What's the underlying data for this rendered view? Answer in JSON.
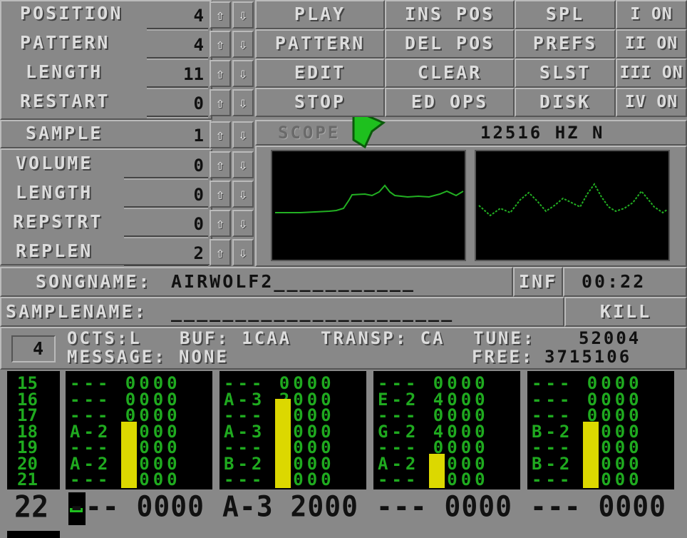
{
  "song_panel": {
    "rows": [
      {
        "label": "POSITION",
        "value": "4"
      },
      {
        "label": "PATTERN",
        "value": "4"
      },
      {
        "label": "LENGTH",
        "value": "11"
      },
      {
        "label": "RESTART",
        "value": "0"
      }
    ],
    "up_icon": "arrow-up-icon",
    "down_icon": "arrow-down-icon"
  },
  "sample_panel": {
    "rows": [
      {
        "label": "SAMPLE",
        "value": "1"
      },
      {
        "label": "VOLUME",
        "value": "0"
      },
      {
        "label": "LENGTH",
        "value": "0"
      },
      {
        "label": "REPSTRT",
        "value": "0"
      },
      {
        "label": "REPLEN",
        "value": "2"
      }
    ]
  },
  "buttons": {
    "col1": [
      "PLAY",
      "PATTERN",
      "EDIT",
      "STOP"
    ],
    "col2": [
      "INS POS",
      "DEL POS",
      "CLEAR",
      "ED OPS"
    ],
    "col3": [
      "SPL",
      "PREFS",
      "SLST",
      "DISK"
    ],
    "channels": [
      "I ON",
      "II ON",
      "III ON",
      "IV ON"
    ]
  },
  "scope": {
    "label": "SCOPE",
    "frequency": "12516 HZ N",
    "trace_color": "#22b022"
  },
  "song": {
    "songname_label": "SONGNAME:",
    "songname_value": "AIRWOLF2___________",
    "inf_button": "INF",
    "time": "00:22"
  },
  "samplename": {
    "label": "SAMPLENAME:",
    "value": "______________________",
    "kill_button": "KILL"
  },
  "info": {
    "octave_box": "4",
    "octs": "OCTS:L",
    "buf": "BUF: 1CAA",
    "transp": "TRANSP: CA",
    "tune_label": "TUNE:",
    "tune_value": "52004",
    "message": "MESSAGE: NONE",
    "free_label": "FREE:",
    "free_value": "3715106"
  },
  "pattern": {
    "row_numbers": [
      "15",
      "16",
      "17",
      "18",
      "19",
      "20",
      "21"
    ],
    "tracks": [
      [
        "--- 0000",
        "--- 0000",
        "--- 0000",
        "A-2 C000",
        "--- 0000",
        "A-2 C000",
        "--- 0000"
      ],
      [
        "--- 0000",
        "A-3 2000",
        "--- 0000",
        "A-3 2000",
        "--- 0000",
        "B-2 9000",
        "--- 0000"
      ],
      [
        "--- 0000",
        "E-2 4000",
        "--- 0000",
        "G-2 4000",
        "--- 0000",
        "A-2 4000",
        "--- 0000"
      ],
      [
        "--- 0000",
        "--- 0000",
        "--- 0000",
        "B-2 9000",
        "--- 0000",
        "B-2 9000",
        "--- 0000"
      ]
    ],
    "vu_levels": [
      0.62,
      0.83,
      0.32,
      0.62
    ],
    "vu_color": "#dcd800",
    "current_row": "22",
    "current": [
      "--- 0000",
      "A-3 2000",
      "--- 0000",
      "--- 0000"
    ]
  },
  "cursor": {
    "icon": "mouse-pointer-icon",
    "color": "#1ec01e"
  }
}
